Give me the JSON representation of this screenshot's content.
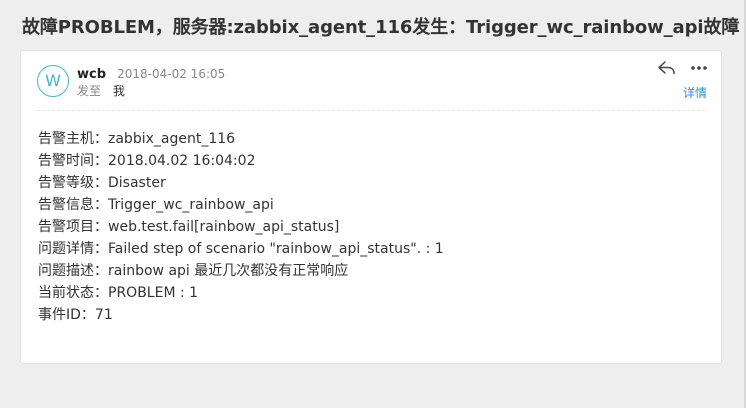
{
  "email": {
    "subject": "故障PROBLEM，服务器:zabbix_agent_116发生：Trigger_wc_rainbow_api故障",
    "sender": {
      "avatar_letter": "W",
      "name": "wcb",
      "date": "2018-04-02 16:05"
    },
    "to_label": "发至",
    "to_value": "我",
    "actions": {
      "reply_icon": "reply-icon",
      "more_icon": "more-icon",
      "details_label": "详情"
    },
    "body_lines": [
      "告警主机：zabbix_agent_116",
      "告警时间：2018.04.02 16:04:02",
      "告警等级：Disaster",
      "告警信息：Trigger_wc_rainbow_api",
      "告警项目：web.test.fail[rainbow_api_status]",
      "问题详情：Failed step of scenario \"rainbow_api_status\". : 1",
      "问题描述：rainbow api 最近几次都没有正常响应",
      "当前状态：PROBLEM : 1",
      "事件ID：71"
    ]
  },
  "colors": {
    "accent": "#45b6c9",
    "link": "#2e8fd1",
    "background": "#eeeeee"
  }
}
